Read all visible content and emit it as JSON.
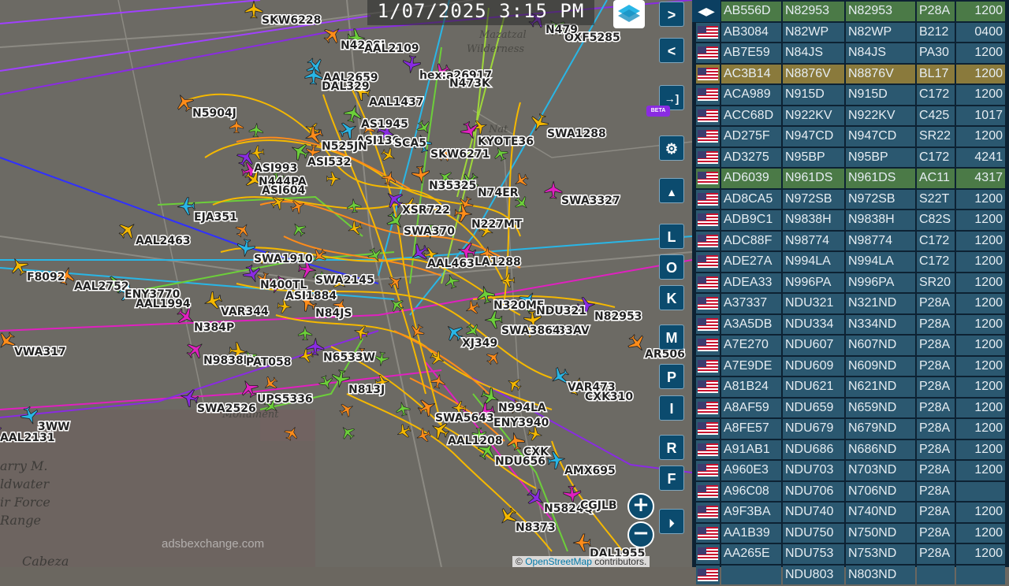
{
  "map": {
    "timestamp": "1/07/2025 3:15 PM",
    "watermark": "adsbexchange.com",
    "attribution_prefix": "©",
    "attribution_link": "OpenStreetMap",
    "attribution_suffix": "contributors.",
    "terrain_labels": [
      "arry M.",
      "ldwater",
      "ir Force",
      "Range",
      "Cabeza"
    ],
    "wilderness_labels": [
      "Mazatzal",
      "Wilderness",
      "Nat",
      "Monument"
    ],
    "flight_labels": [
      "SKW6228",
      "N420SJ",
      "AAL2109",
      "AAL2659",
      "hex:a26917",
      "N473K",
      "AAL1437",
      "N5904J",
      "AS1945",
      "ASI139",
      "SCA5",
      "KYOTE36",
      "SWA1288",
      "N525JN",
      "ASI532",
      "SKW6271",
      "ASI993",
      "N444PA",
      "ASI604",
      "N35325",
      "N74ER",
      "EJA351",
      "XSR722",
      "SWA3327",
      "AAL2463",
      "N227MT",
      "SWA370",
      "SWA1910",
      "AAL463",
      "LA1288",
      "F8092",
      "AAL2752",
      "ENY3770",
      "AAL1994",
      "N400TL",
      "ASI1884",
      "VAR344",
      "N84JS",
      "N320ME",
      "NDU321",
      "N82953",
      "N384P",
      "N233AV",
      "VWA317",
      "SWA3864",
      "XJ349",
      "N6533W",
      "N9838H",
      "PAT058",
      "AR506",
      "N813J",
      "VAR473",
      "SWA2526",
      "UPS5336",
      "CXK310",
      "SWA5643",
      "N994LA",
      "3WW",
      "AAL2131",
      "ENY3940",
      "AAL1208",
      "CXK",
      "NDU656",
      "AMX695",
      "N5824Q",
      "CGJLB",
      "N8373",
      "DAL1955",
      "OXF5285",
      "DAL329",
      "N479",
      "SWA2145"
    ],
    "buttons": {
      "next": ">",
      "prev": "<",
      "exit": "→]",
      "beta": "BETA",
      "letters": [
        "L",
        "O",
        "K",
        "M",
        "P",
        "I",
        "R",
        "F"
      ],
      "zoom_in": "+",
      "zoom_out": "−"
    },
    "colors": {
      "track_yellow": "#f5b800",
      "track_orange": "#ff8c1a",
      "track_green": "#6ccf3a",
      "track_cyan": "#29b6e6",
      "track_purple": "#8a2be2",
      "track_magenta": "#e020c0",
      "track_blue": "#3030ff",
      "panel_bg": "#0d2233",
      "row_bg": "#2b5870",
      "row_green": "#4b7a47",
      "row_olive": "#8a7a3c"
    }
  },
  "sidebar": {
    "toggle_label": "◀▶",
    "rows": [
      {
        "hex": "AB556D",
        "reg": "N82953",
        "call": "N82953",
        "type": "P28A",
        "alt": "1200",
        "style": "green"
      },
      {
        "hex": "AB3084",
        "reg": "N82WP",
        "call": "N82WP",
        "type": "B212",
        "alt": "0400",
        "style": ""
      },
      {
        "hex": "AB7E59",
        "reg": "N84JS",
        "call": "N84JS",
        "type": "PA30",
        "alt": "1200",
        "style": ""
      },
      {
        "hex": "AC3B14",
        "reg": "N8876V",
        "call": "N8876V",
        "type": "BL17",
        "alt": "1200",
        "style": "olive"
      },
      {
        "hex": "ACA989",
        "reg": "N915D",
        "call": "N915D",
        "type": "C172",
        "alt": "1200",
        "style": ""
      },
      {
        "hex": "ACC68D",
        "reg": "N922KV",
        "call": "N922KV",
        "type": "C425",
        "alt": "1017",
        "style": ""
      },
      {
        "hex": "AD275F",
        "reg": "N947CD",
        "call": "N947CD",
        "type": "SR22",
        "alt": "1200",
        "style": ""
      },
      {
        "hex": "AD3275",
        "reg": "N95BP",
        "call": "N95BP",
        "type": "C172",
        "alt": "4241",
        "style": ""
      },
      {
        "hex": "AD6039",
        "reg": "N961DS",
        "call": "N961DS",
        "type": "AC11",
        "alt": "4317",
        "style": "green"
      },
      {
        "hex": "AD8CA5",
        "reg": "N972SB",
        "call": "N972SB",
        "type": "S22T",
        "alt": "1200",
        "style": ""
      },
      {
        "hex": "ADB9C1",
        "reg": "N9838H",
        "call": "N9838H",
        "type": "C82S",
        "alt": "1200",
        "style": ""
      },
      {
        "hex": "ADC88F",
        "reg": "N98774",
        "call": "N98774",
        "type": "C172",
        "alt": "1200",
        "style": ""
      },
      {
        "hex": "ADE27A",
        "reg": "N994LA",
        "call": "N994LA",
        "type": "C172",
        "alt": "1200",
        "style": ""
      },
      {
        "hex": "ADEA33",
        "reg": "N996PA",
        "call": "N996PA",
        "type": "SR20",
        "alt": "1200",
        "style": ""
      },
      {
        "hex": "A37337",
        "reg": "NDU321",
        "call": "N321ND",
        "type": "P28A",
        "alt": "1200",
        "style": ""
      },
      {
        "hex": "A3A5DB",
        "reg": "NDU334",
        "call": "N334ND",
        "type": "P28A",
        "alt": "1200",
        "style": ""
      },
      {
        "hex": "A7E270",
        "reg": "NDU607",
        "call": "N607ND",
        "type": "P28A",
        "alt": "1200",
        "style": ""
      },
      {
        "hex": "A7E9DE",
        "reg": "NDU609",
        "call": "N609ND",
        "type": "P28A",
        "alt": "1200",
        "style": ""
      },
      {
        "hex": "A81B24",
        "reg": "NDU621",
        "call": "N621ND",
        "type": "P28A",
        "alt": "1200",
        "style": ""
      },
      {
        "hex": "A8AF59",
        "reg": "NDU659",
        "call": "N659ND",
        "type": "P28A",
        "alt": "1200",
        "style": ""
      },
      {
        "hex": "A8FE57",
        "reg": "NDU679",
        "call": "N679ND",
        "type": "P28A",
        "alt": "1200",
        "style": ""
      },
      {
        "hex": "A91AB1",
        "reg": "NDU686",
        "call": "N686ND",
        "type": "P28A",
        "alt": "1200",
        "style": ""
      },
      {
        "hex": "A960E3",
        "reg": "NDU703",
        "call": "N703ND",
        "type": "P28A",
        "alt": "1200",
        "style": ""
      },
      {
        "hex": "A96C08",
        "reg": "NDU706",
        "call": "N706ND",
        "type": "P28A",
        "alt": "",
        "style": ""
      },
      {
        "hex": "A9F3BA",
        "reg": "NDU740",
        "call": "N740ND",
        "type": "P28A",
        "alt": "1200",
        "style": ""
      },
      {
        "hex": "AA1B39",
        "reg": "NDU750",
        "call": "N750ND",
        "type": "P28A",
        "alt": "1200",
        "style": ""
      },
      {
        "hex": "AA265E",
        "reg": "NDU753",
        "call": "N753ND",
        "type": "P28A",
        "alt": "1200",
        "style": ""
      },
      {
        "hex": "",
        "reg": "NDU803",
        "call": "N803ND",
        "type": "",
        "alt": "",
        "style": ""
      }
    ]
  }
}
